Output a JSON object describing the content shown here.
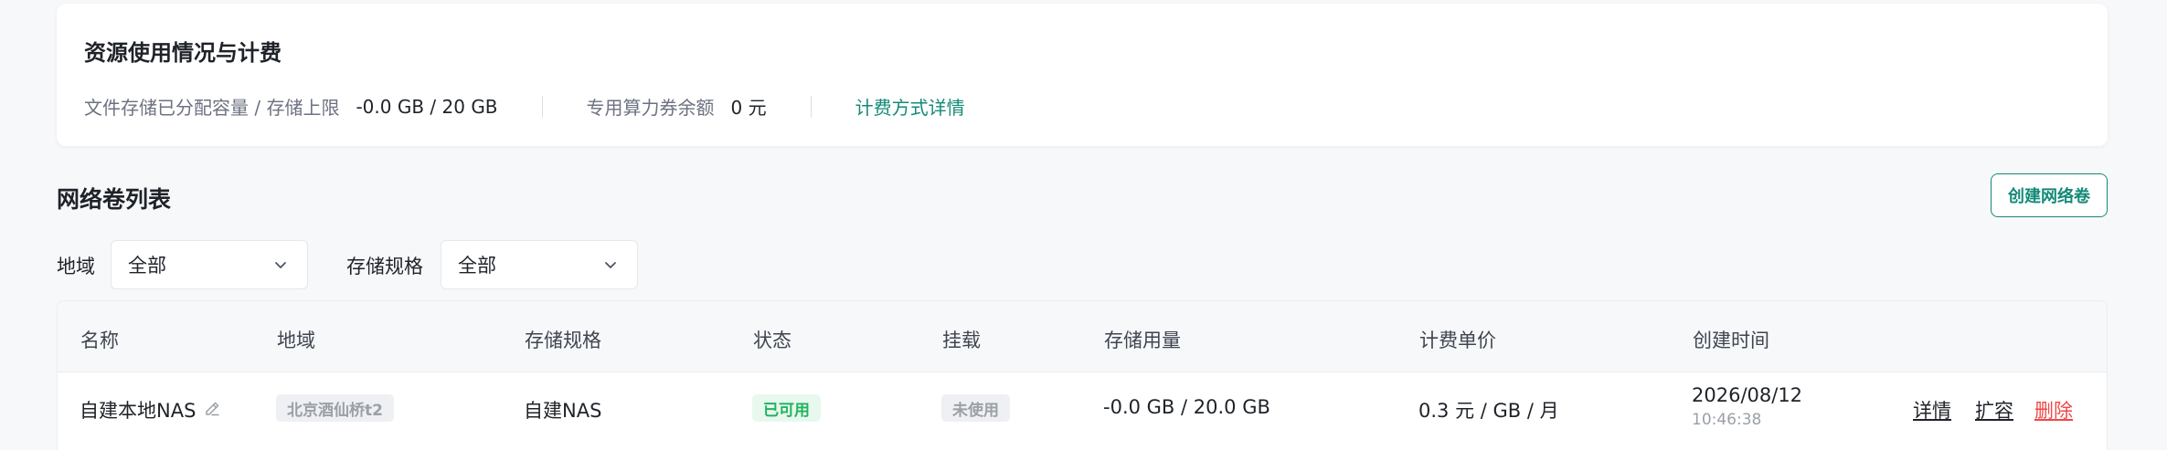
{
  "usage_card": {
    "title": "资源使用情况与计费",
    "storage_label": "文件存储已分配容量 / 存储上限",
    "storage_value": "-0.0 GB / 20 GB",
    "voucher_label": "专用算力券余额",
    "voucher_value": "0 元",
    "billing_link": "计费方式详情"
  },
  "section": {
    "title": "网络卷列表",
    "create_button": "创建网络卷"
  },
  "filters": {
    "region_label": "地域",
    "region_value": "全部",
    "spec_label": "存储规格",
    "spec_value": "全部"
  },
  "table": {
    "headers": [
      "名称",
      "地域",
      "存储规格",
      "状态",
      "挂载",
      "存储用量",
      "计费单价",
      "创建时间"
    ],
    "rows": [
      {
        "name": "自建本地NAS",
        "region": "北京酒仙桥t2",
        "spec": "自建NAS",
        "status": "已可用",
        "mount": "未使用",
        "usage": "-0.0 GB / 20.0 GB",
        "price": "0.3 元 / GB / 月",
        "created_date": "2026/08/12",
        "created_time": "10:46:38",
        "actions": [
          "详情",
          "扩容",
          "删除"
        ]
      }
    ]
  },
  "colors": {
    "accent": "#138a77",
    "danger": "#f04848",
    "status_green": "#22b35e"
  },
  "icons": [
    "chevron-down-icon",
    "edit-pencil-icon"
  ]
}
